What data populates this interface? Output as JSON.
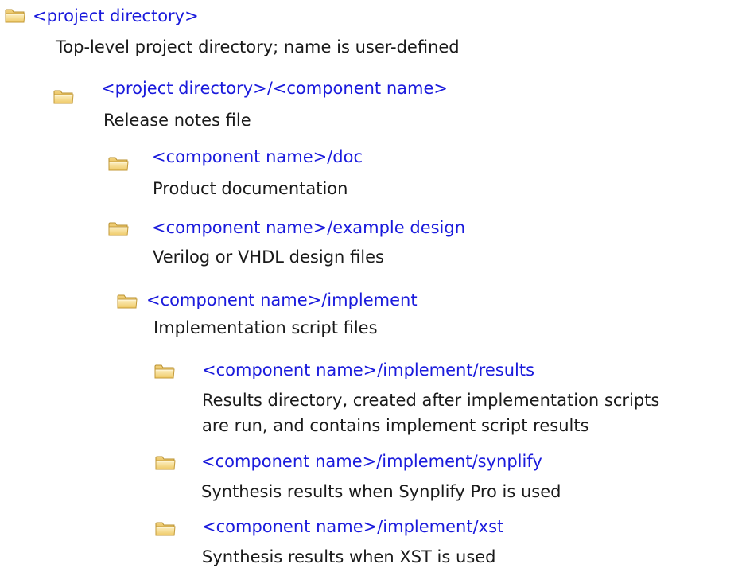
{
  "entries": [
    {
      "path": "<project directory>",
      "description": [
        "Top-level project directory; name is user-defined"
      ],
      "icon": "folder-icon"
    },
    {
      "path": "<project directory>/<component name>",
      "description": [
        "Release notes file"
      ],
      "icon": "folder-icon"
    },
    {
      "path": "<component name>/doc",
      "description": [
        "Product documentation"
      ],
      "icon": "folder-icon"
    },
    {
      "path": "<component name>/example design",
      "description": [
        "Verilog or VHDL design files"
      ],
      "icon": "folder-icon"
    },
    {
      "path": "<component name>/implement",
      "description": [
        "Implementation script files"
      ],
      "icon": "folder-icon"
    },
    {
      "path": "<component name>/implement/results",
      "description": [
        "Results directory, created after implementation scripts",
        "are run, and contains implement script results"
      ],
      "icon": "folder-icon"
    },
    {
      "path": "<component name>/implement/synplify",
      "description": [
        "Synthesis results when Synplify Pro is used"
      ],
      "icon": "folder-icon"
    },
    {
      "path": "<component name>/implement/xst",
      "description": [
        "Synthesis results when XST is used"
      ],
      "icon": "folder-icon"
    }
  ],
  "colors": {
    "link": "#1a1adc",
    "text": "#1a1a1a",
    "folder_light": "#fbe6a6",
    "folder_mid": "#f3cd6a",
    "folder_dark": "#c9a13c"
  }
}
